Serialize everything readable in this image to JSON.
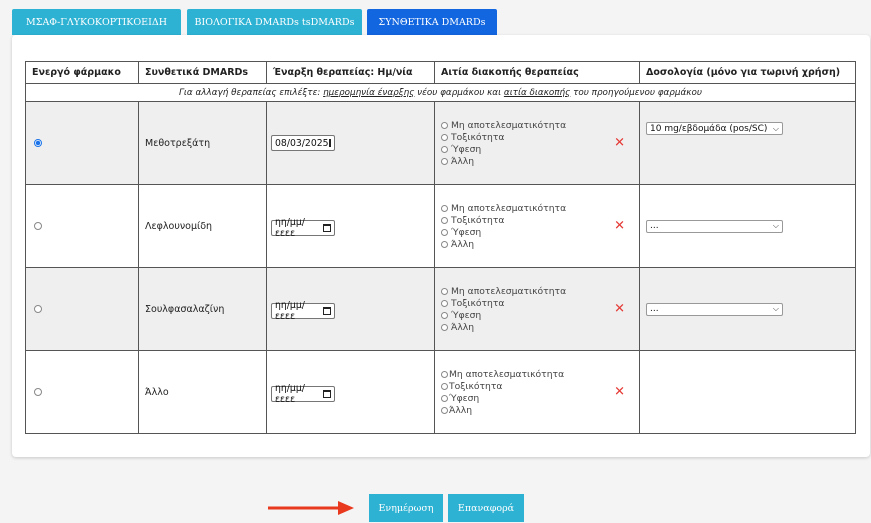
{
  "tabs": [
    {
      "label": "ΜΣΑΦ-ΓΛΥΚΟΚΟΡΤΙΚΟΕΙΔΗ",
      "active": false
    },
    {
      "label": "ΒΙΟΛΟΓΙΚΑ DMARDs tsDMARDs",
      "active": false
    },
    {
      "label": "ΣΥΝΘΕΤΙΚΑ DMARDs",
      "active": true
    }
  ],
  "table": {
    "headers": [
      "Ενεργό φάρμακο",
      "Συνθετικά DMARDs",
      "Έναρξη θεραπείας: Ημ/νία",
      "Αιτία διακοπής θεραπείας",
      "Δοσολογία (μόνο για τωρινή χρήση)"
    ],
    "note": {
      "prefix": "Για αλλαγή θεραπείας επιλέξτε: ",
      "link1": "ημερομηνία έναρξης",
      "middle": " νέου φαρμάκου και ",
      "link2": "αιτία διακοπής",
      "suffix": " του προηγούμενου φαρμάκου"
    },
    "rows": [
      {
        "active": true,
        "name": "Μεθοτρεξάτη",
        "date": "08/03/2025",
        "reasons": [
          "Μη αποτελεσματικότητα",
          "Τοξικότητα",
          "Ύφεση",
          "Άλλη"
        ],
        "dose": "10 mg/εβδομάδα (pos/SC)"
      },
      {
        "active": false,
        "name": "Λεφλουνομίδη",
        "date": "ηη/μμ/εεεε",
        "reasons": [
          "Μη αποτελεσματικότητα",
          "Τοξικότητα",
          "Ύφεση",
          "Άλλη"
        ],
        "dose": "..."
      },
      {
        "active": false,
        "name": "Σουλφασαλαζίνη",
        "date": "ηη/μμ/εεεε",
        "reasons": [
          "Μη αποτελεσματικότητα",
          "Τοξικότητα",
          "Ύφεση",
          "Άλλη"
        ],
        "dose": "..."
      },
      {
        "active": false,
        "name": "Άλλο",
        "date": "ηη/μμ/εεεε",
        "reasons": [
          "Μη αποτελεσματικότητα",
          "Τοξικότητα",
          "Ύφεση",
          "Άλλη"
        ],
        "dose": null
      }
    ]
  },
  "buttons": {
    "update": "Ενημέρωση",
    "reset": "Επαναφορά"
  },
  "colors": {
    "tab": "#2eb2d3",
    "tab_active": "#1266e0",
    "clear_x": "#e53935",
    "arrow": "#e8381d"
  }
}
